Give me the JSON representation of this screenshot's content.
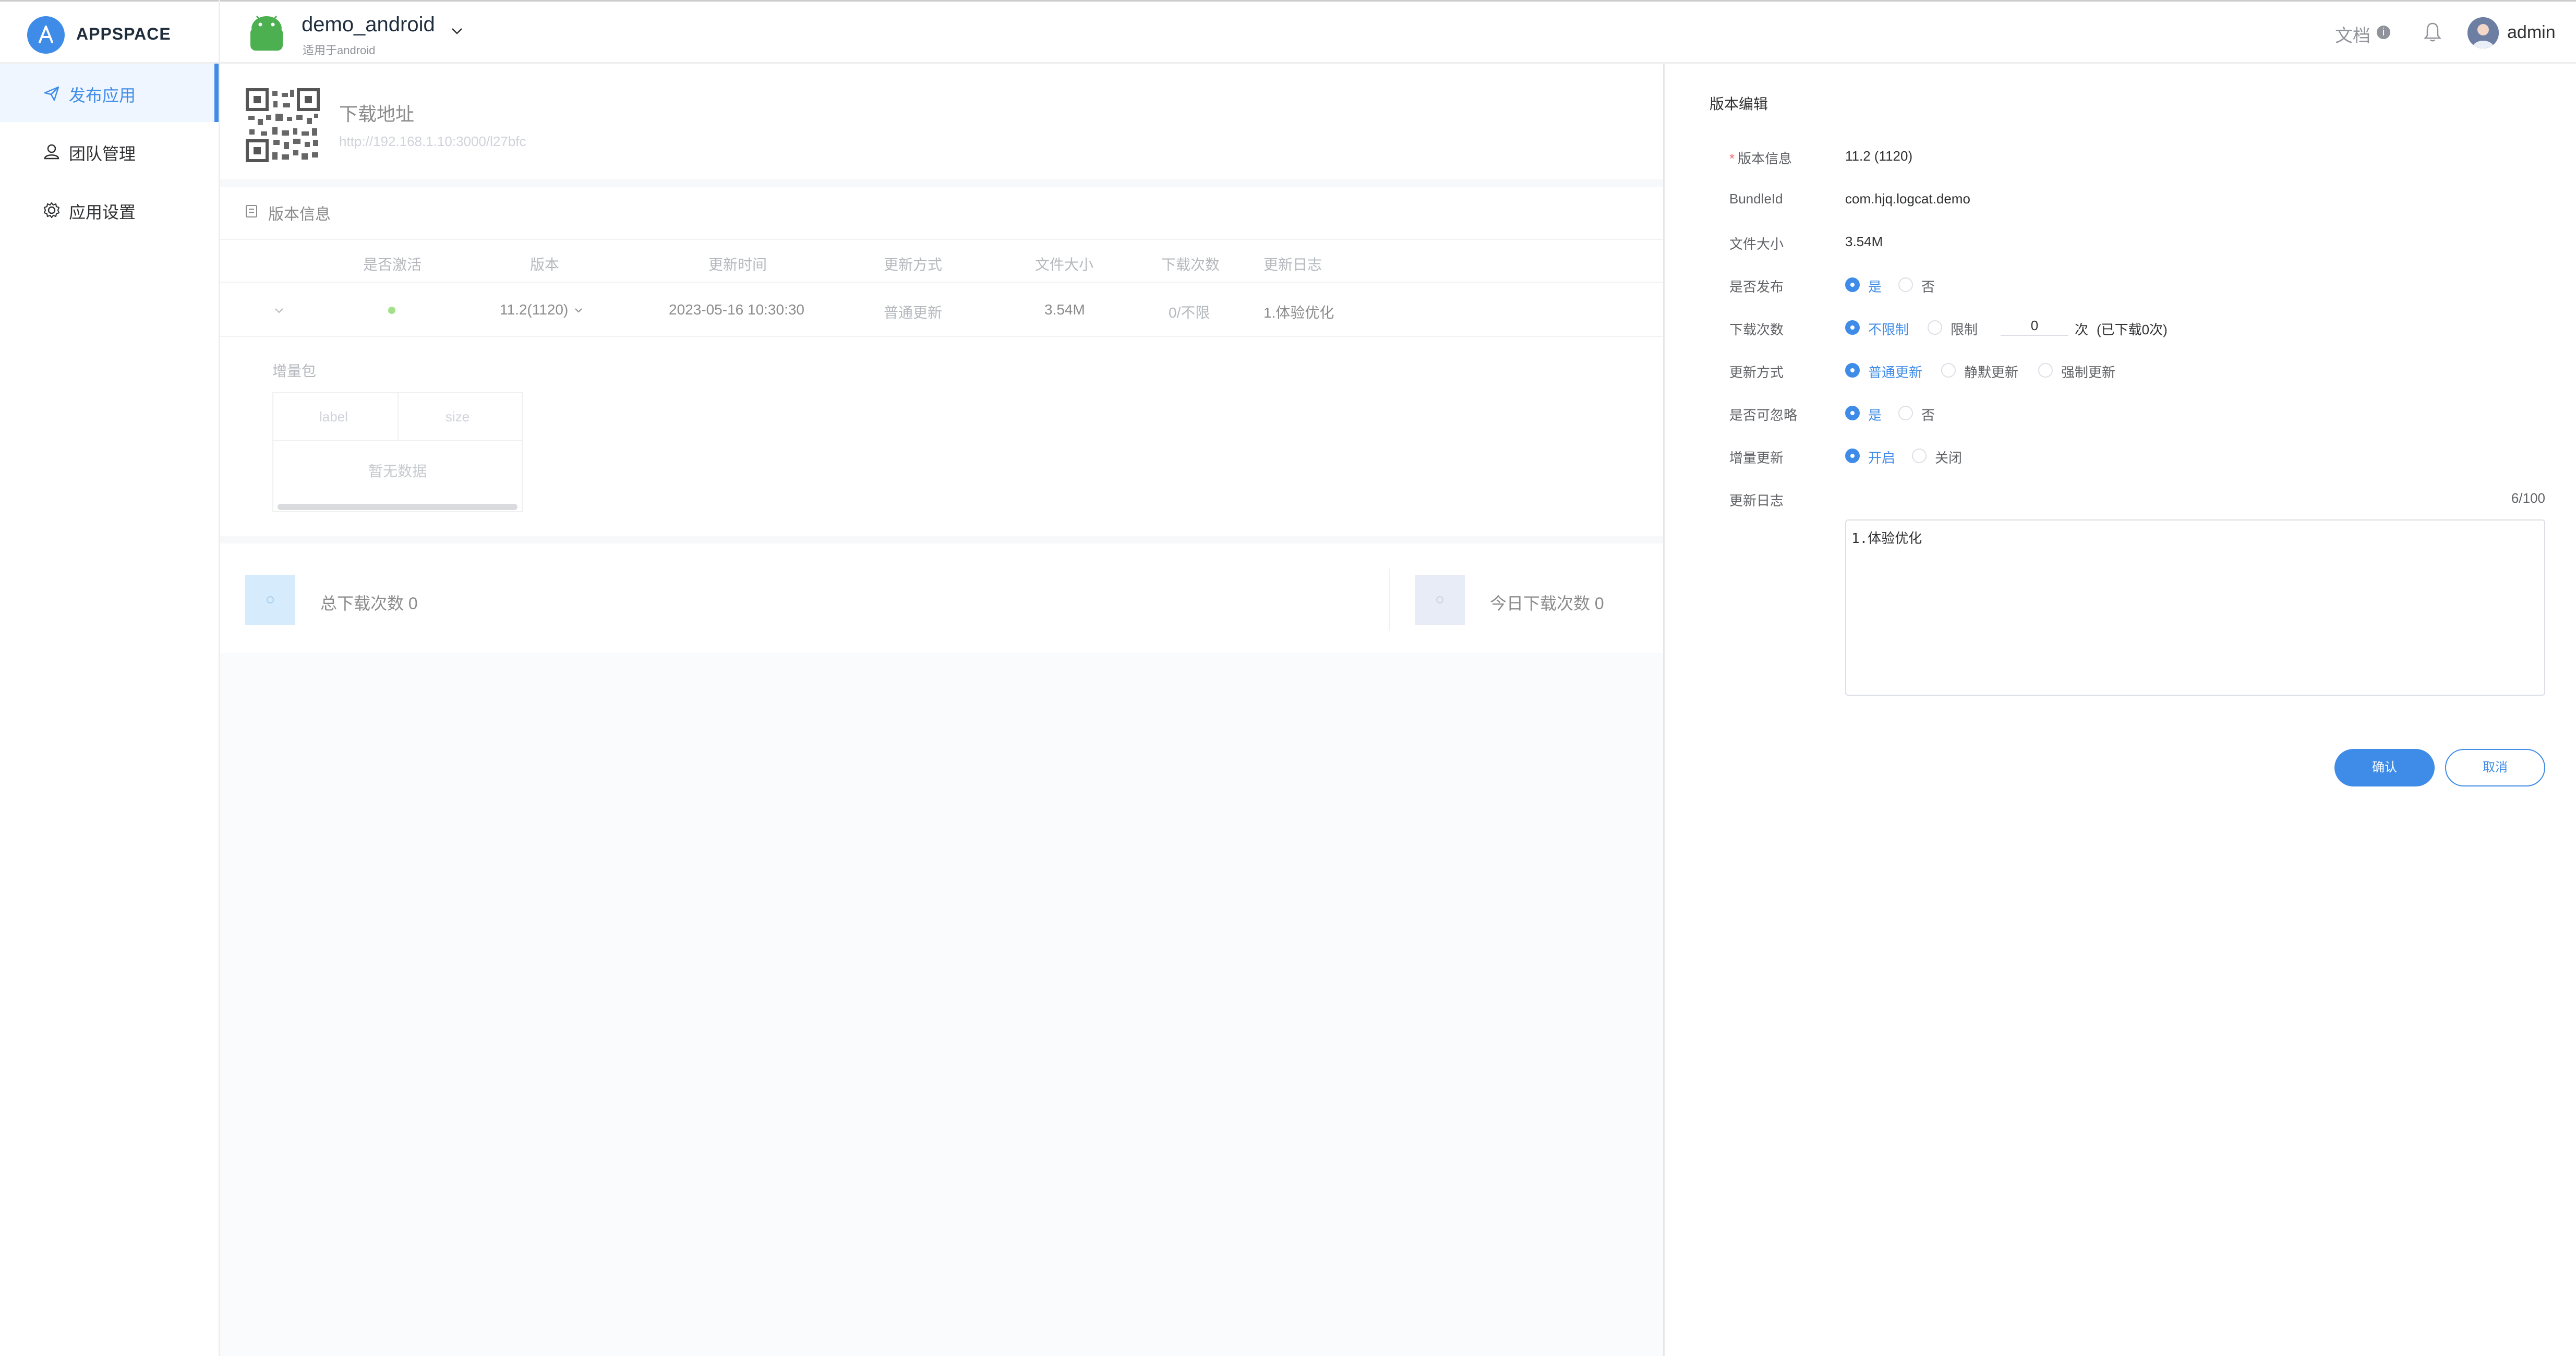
{
  "header": {
    "brand": "APPSPACE",
    "app_name": "demo_android",
    "app_sub": "适用于android",
    "doc_link": "文档",
    "info_glyph": "i",
    "user_name": "admin"
  },
  "sidebar": {
    "items": [
      {
        "label": "发布应用",
        "icon": "send-icon",
        "active": true
      },
      {
        "label": "团队管理",
        "icon": "team-icon",
        "active": false
      },
      {
        "label": "应用设置",
        "icon": "gear-icon",
        "active": false
      }
    ]
  },
  "main": {
    "download_title": "下载地址",
    "download_url": "http://192.168.1.10:3000/l27bfc",
    "version_section_title": "版本信息",
    "table": {
      "columns": [
        "是否激活",
        "版本",
        "更新时间",
        "更新方式",
        "文件大小",
        "下载次数",
        "更新日志"
      ],
      "row": {
        "version": "11.2(1120)",
        "updated_at": "2023-05-16 10:30:30",
        "update_mode": "普通更新",
        "file_size": "3.54M",
        "downloads": "0/不限",
        "changelog": "1.体验优化"
      }
    },
    "incremental": {
      "label": "增量包",
      "columns": [
        "label",
        "size"
      ],
      "empty": "暂无数据"
    },
    "stats": {
      "total_downloads": "总下载次数 0",
      "today_downloads": "今日下载次数 0"
    }
  },
  "drawer": {
    "title": "版本编辑",
    "fields": {
      "version_label": "版本信息",
      "version_value": "11.2 (1120)",
      "bundle_label": "BundleId",
      "bundle_value": "com.hjq.logcat.demo",
      "size_label": "文件大小",
      "size_value": "3.54M",
      "publish_label": "是否发布",
      "publish_yes": "是",
      "publish_no": "否",
      "download_label": "下载次数",
      "download_unlimited": "不限制",
      "download_limited": "限制",
      "download_limit_value": "0",
      "download_unit": "次",
      "download_done": "(已下载0次)",
      "mode_label": "更新方式",
      "mode_normal": "普通更新",
      "mode_silent": "静默更新",
      "mode_force": "强制更新",
      "ignore_label": "是否可忽略",
      "ignore_yes": "是",
      "ignore_no": "否",
      "increment_label": "增量更新",
      "increment_on": "开启",
      "increment_off": "关闭",
      "changelog_label": "更新日志",
      "changelog_counter": "6/100",
      "changelog_value": "1.体验优化"
    },
    "confirm_label": "确认",
    "cancel_label": "取消"
  },
  "colors": {
    "primary": "#3f8ce8",
    "required": "#f56c6c",
    "active_dot": "#a3e08a"
  }
}
